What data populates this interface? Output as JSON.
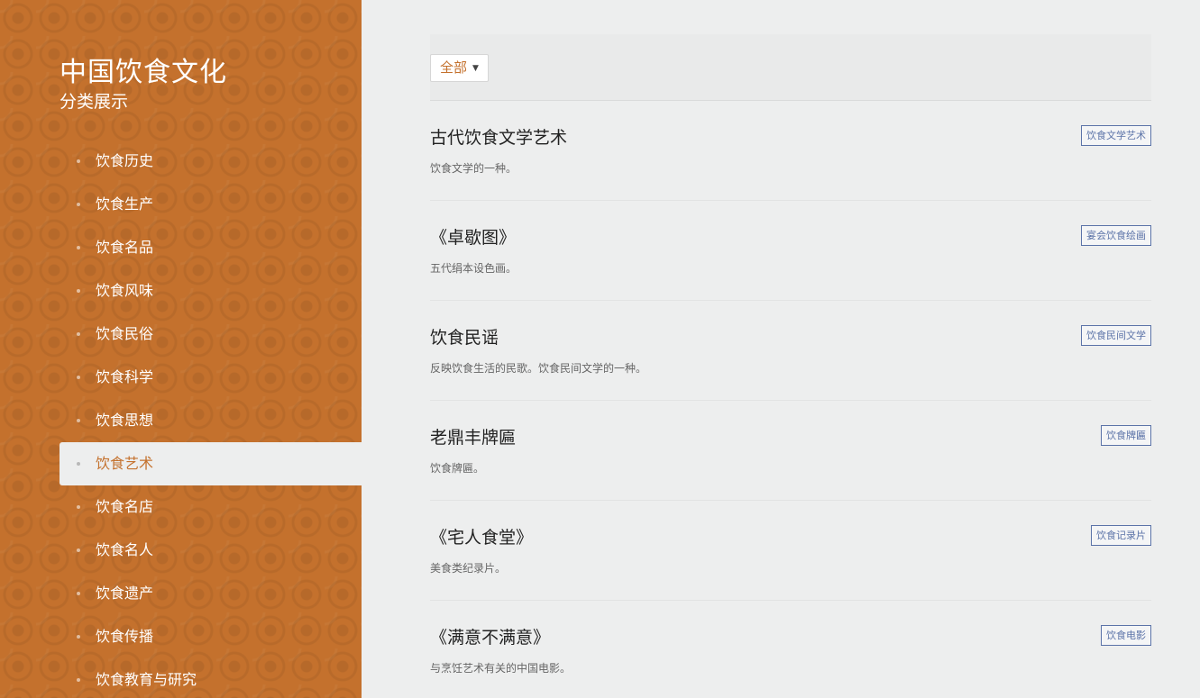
{
  "sidebar": {
    "title": "中国饮食文化",
    "subtitle": "分类展示",
    "items": [
      {
        "label": "饮食历史",
        "active": false
      },
      {
        "label": "饮食生产",
        "active": false
      },
      {
        "label": "饮食名品",
        "active": false
      },
      {
        "label": "饮食风味",
        "active": false
      },
      {
        "label": "饮食民俗",
        "active": false
      },
      {
        "label": "饮食科学",
        "active": false
      },
      {
        "label": "饮食思想",
        "active": false
      },
      {
        "label": "饮食艺术",
        "active": true
      },
      {
        "label": "饮食名店",
        "active": false
      },
      {
        "label": "饮食名人",
        "active": false
      },
      {
        "label": "饮食遗产",
        "active": false
      },
      {
        "label": "饮食传播",
        "active": false
      },
      {
        "label": "饮食教育与研究",
        "active": false
      }
    ]
  },
  "filter": {
    "selected": "全部",
    "caret": "▼"
  },
  "entries": [
    {
      "title": "古代饮食文学艺术",
      "desc": "饮食文学的一种。",
      "tag": "饮食文学艺术"
    },
    {
      "title": "《卓歇图》",
      "desc": "五代绢本设色画。",
      "tag": "宴会饮食绘画"
    },
    {
      "title": "饮食民谣",
      "desc": "反映饮食生活的民歌。饮食民间文学的一种。",
      "tag": "饮食民间文学"
    },
    {
      "title": "老鼎丰牌匾",
      "desc": "饮食牌匾。",
      "tag": "饮食牌匾"
    },
    {
      "title": "《宅人食堂》",
      "desc": "美食类纪录片。",
      "tag": "饮食记录片"
    },
    {
      "title": "《满意不满意》",
      "desc": "与烹饪艺术有关的中国电影。",
      "tag": "饮食电影"
    }
  ],
  "colors": {
    "brand": "#c4712d",
    "tag": "#5b73a8",
    "background": "#edeeee"
  }
}
